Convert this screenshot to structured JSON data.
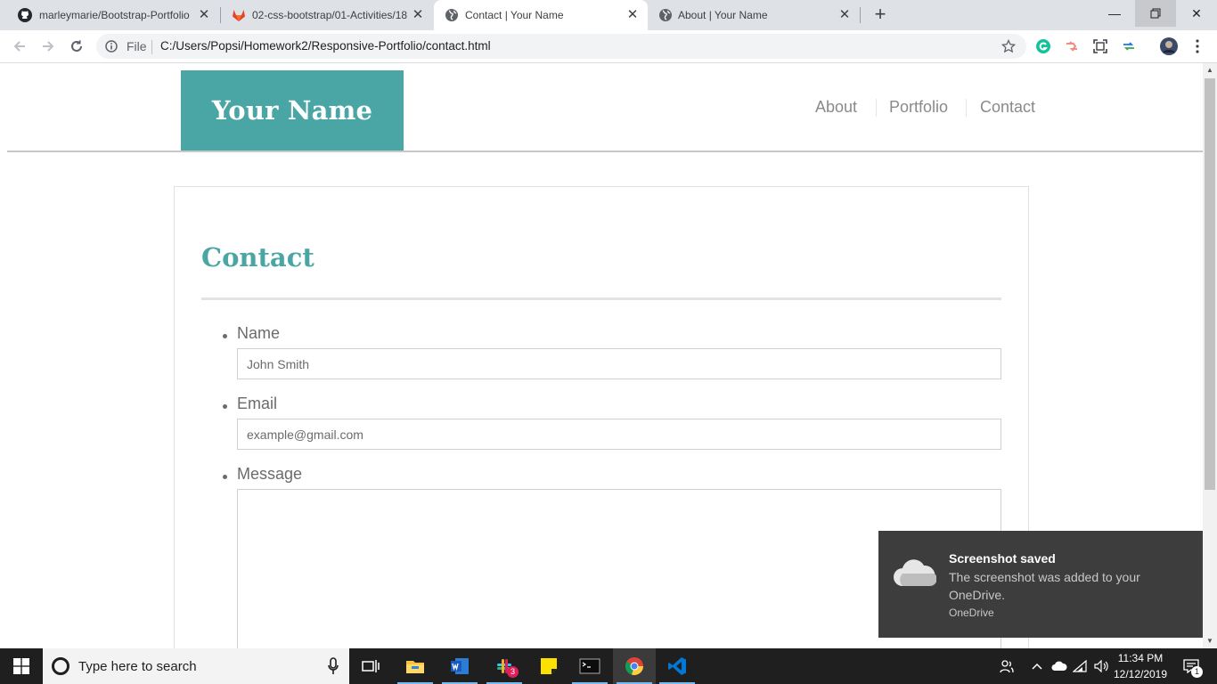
{
  "browser": {
    "tabs": [
      {
        "title": "marleymarie/Bootstrap-Portfolio",
        "favicon": "github-icon"
      },
      {
        "title": "02-css-bootstrap/01-Activities/18",
        "favicon": "gitlab-icon"
      },
      {
        "title": "Contact | Your Name",
        "favicon": "globe-icon",
        "active": true
      },
      {
        "title": "About | Your Name",
        "favicon": "globe-icon"
      }
    ],
    "address": {
      "scheme_label": "File",
      "url": "C:/Users/Popsi/Homework2/Responsive-Portfolio/contact.html"
    }
  },
  "site": {
    "brand": "Your Name",
    "nav": [
      "About",
      "Portfolio",
      "Contact"
    ],
    "accent_color": "#4aa6a4"
  },
  "contact": {
    "title": "Contact",
    "fields": {
      "name": {
        "label": "Name",
        "placeholder": "John Smith"
      },
      "email": {
        "label": "Email",
        "placeholder": "example@gmail.com"
      },
      "message": {
        "label": "Message",
        "placeholder": ""
      }
    }
  },
  "toast": {
    "title": "Screenshot saved",
    "body": "The screenshot was added to your OneDrive.",
    "app": "OneDrive"
  },
  "taskbar": {
    "search_placeholder": "Type here to search",
    "slack_badge": "3",
    "notification_count": "1",
    "time": "11:34 PM",
    "date": "12/12/2019"
  }
}
